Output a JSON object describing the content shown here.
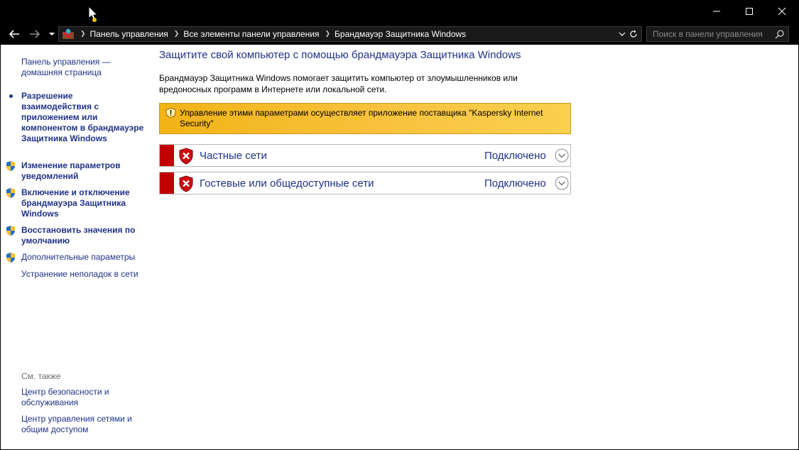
{
  "window": {
    "controls": [
      {
        "name": "minimize-icon"
      },
      {
        "name": "maximize-icon"
      },
      {
        "name": "close-icon"
      }
    ]
  },
  "address_bar": {
    "breadcrumbs": [
      "Панель управления",
      "Все элементы панели управления",
      "Брандмауэр Защитника Windows"
    ],
    "search_placeholder": "Поиск в панели управления"
  },
  "sidebar": {
    "home_link": "Панель управления — домашняя страница",
    "links": [
      {
        "label": "Разрешение взаимодействия с приложением или компонентом в брандмауэре Защитника Windows",
        "icon": "bullet",
        "bold": true
      },
      {
        "label": "Изменение параметров уведомлений",
        "icon": "uac-shield-icon",
        "bold": true
      },
      {
        "label": "Включение и отключение брандмауэра Защитника Windows",
        "icon": "uac-shield-icon",
        "bold": true
      },
      {
        "label": "Восстановить значения по умолчанию",
        "icon": "uac-shield-icon",
        "bold": true
      },
      {
        "label": "Дополнительные параметры",
        "icon": "uac-shield-icon",
        "bold": false
      },
      {
        "label": "Устранение неполадок в сети",
        "icon": "",
        "bold": false
      }
    ],
    "see_also_heading": "См. также",
    "see_also": [
      "Центр безопасности и обслуживания",
      "Центр управления сетями и общим доступом"
    ]
  },
  "main": {
    "title": "Защитите свой компьютер с помощью брандмауэра Защитника Windows",
    "description": "Брандмауэр Защитника Windows помогает защитить компьютер от злоумышленников или вредоносных программ в Интернете или локальной сети.",
    "warning": "Управление этими параметрами осуществляет приложение поставщика \"Kaspersky Internet Security\"",
    "networks": [
      {
        "name": "Частные сети",
        "status": "Подключено"
      },
      {
        "name": "Гостевые или общедоступные сети",
        "status": "Подключено"
      }
    ]
  },
  "colors": {
    "link": "#1e3287",
    "warning_bg": "#f8c23e",
    "network_bar": "#c00000",
    "chrome_bg": "#000000"
  }
}
